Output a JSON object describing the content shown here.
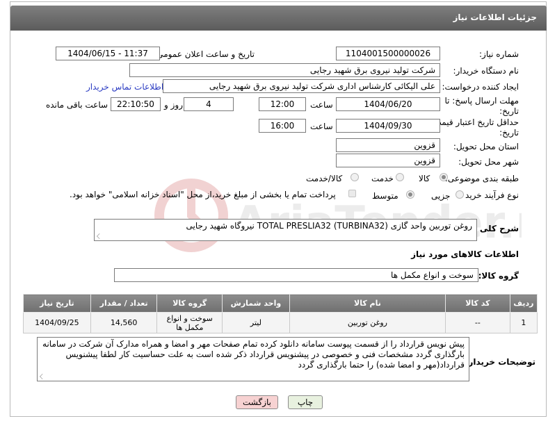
{
  "header": {
    "title": "جزئیات اطلاعات نیاز"
  },
  "form": {
    "need_number_label": "شماره نیاز:",
    "need_number": "1104001500000026",
    "announce_label": "تاریخ و ساعت اعلان عمومی:",
    "announce_value": "1404/06/15 - 11:37",
    "buyer_org_label": "نام دستگاه خریدار:",
    "buyer_org": "شرکت تولید نیروی برق شهید رجایی",
    "creator_label": "ایجاد کننده درخواست:",
    "creator": "علی الیکائی کارشناس اداری شرکت تولید نیروی برق شهید رجایی",
    "contact_link": "اطلاعات تماس خریدار",
    "reply_deadline_label": "مهلت ارسال پاسخ: تا تاریخ:",
    "reply_date": "1404/06/20",
    "time_label": "ساعت",
    "reply_time": "12:00",
    "days_value": "4",
    "days_label": "روز و",
    "remaining_time": "22:10:50",
    "remaining_label": "ساعت باقی مانده",
    "price_validity_label": "حداقل تاریخ اعتبار قیمت: تا تاریخ:",
    "validity_date": "1404/09/30",
    "validity_time_label": "ساعت",
    "validity_time": "16:00",
    "province_label": "استان محل تحویل:",
    "province": "قزوین",
    "city_label": "شهر محل تحویل:",
    "city": "قزوین",
    "category_label": "طبقه بندی موضوعی:",
    "category_options": [
      "کالا",
      "خدمت",
      "کالا/خدمت"
    ],
    "process_label": "نوع فرآیند خرید :",
    "process_options": [
      "جزیی",
      "متوسط"
    ],
    "payment_note": "پرداخت تمام یا بخشی از مبلغ خرید،از محل \"اسناد خزانه اسلامی\" خواهد بود.",
    "description_label": "شرح کلی نیاز:",
    "description": "روغن توربین واحد گازی TOTAL PRESLIA32 (TURBINA32) نیروگاه شهید رجایی"
  },
  "goods": {
    "section_title": "اطلاعات کالاهای مورد نیاز",
    "group_label": "گروه کالا:",
    "group_value": "سوخت و انواع مکمل ها",
    "columns": [
      "ردیف",
      "کد کالا",
      "نام کالا",
      "واحد شمارش",
      "گروه کالا",
      "تعداد / مقدار",
      "تاریخ نیاز"
    ],
    "rows": [
      [
        "1",
        "--",
        "روغن توربین",
        "لیتر",
        "سوخت و انواع مکمل ها",
        "14,560",
        "1404/09/25"
      ]
    ]
  },
  "notes": {
    "label": "توضیحات خریدار:",
    "text": "پیش نویس قرارداد را از قسمت پیوست سامانه دانلود کرده تمام صفحات مهر و امضا و همراه مدارک آن شرکت در سامانه بارگذاری گردد مشخصات فنی و خصوصی در پیشنویس قرارداد ذکر شده است به علت حساسیت کار  لطفا  پیشنویس قرارداد(مهر و امضا شده)  را حتما بارگذاری گردد"
  },
  "buttons": {
    "print": "چاپ",
    "back": "بازگشت"
  },
  "watermark": {
    "text": "AriaTender.net"
  },
  "colors": {
    "header": "#6b6b6b",
    "link": "#2a3bc2",
    "back_button": "#f7d2d2",
    "print_button": "#e8f1df"
  }
}
